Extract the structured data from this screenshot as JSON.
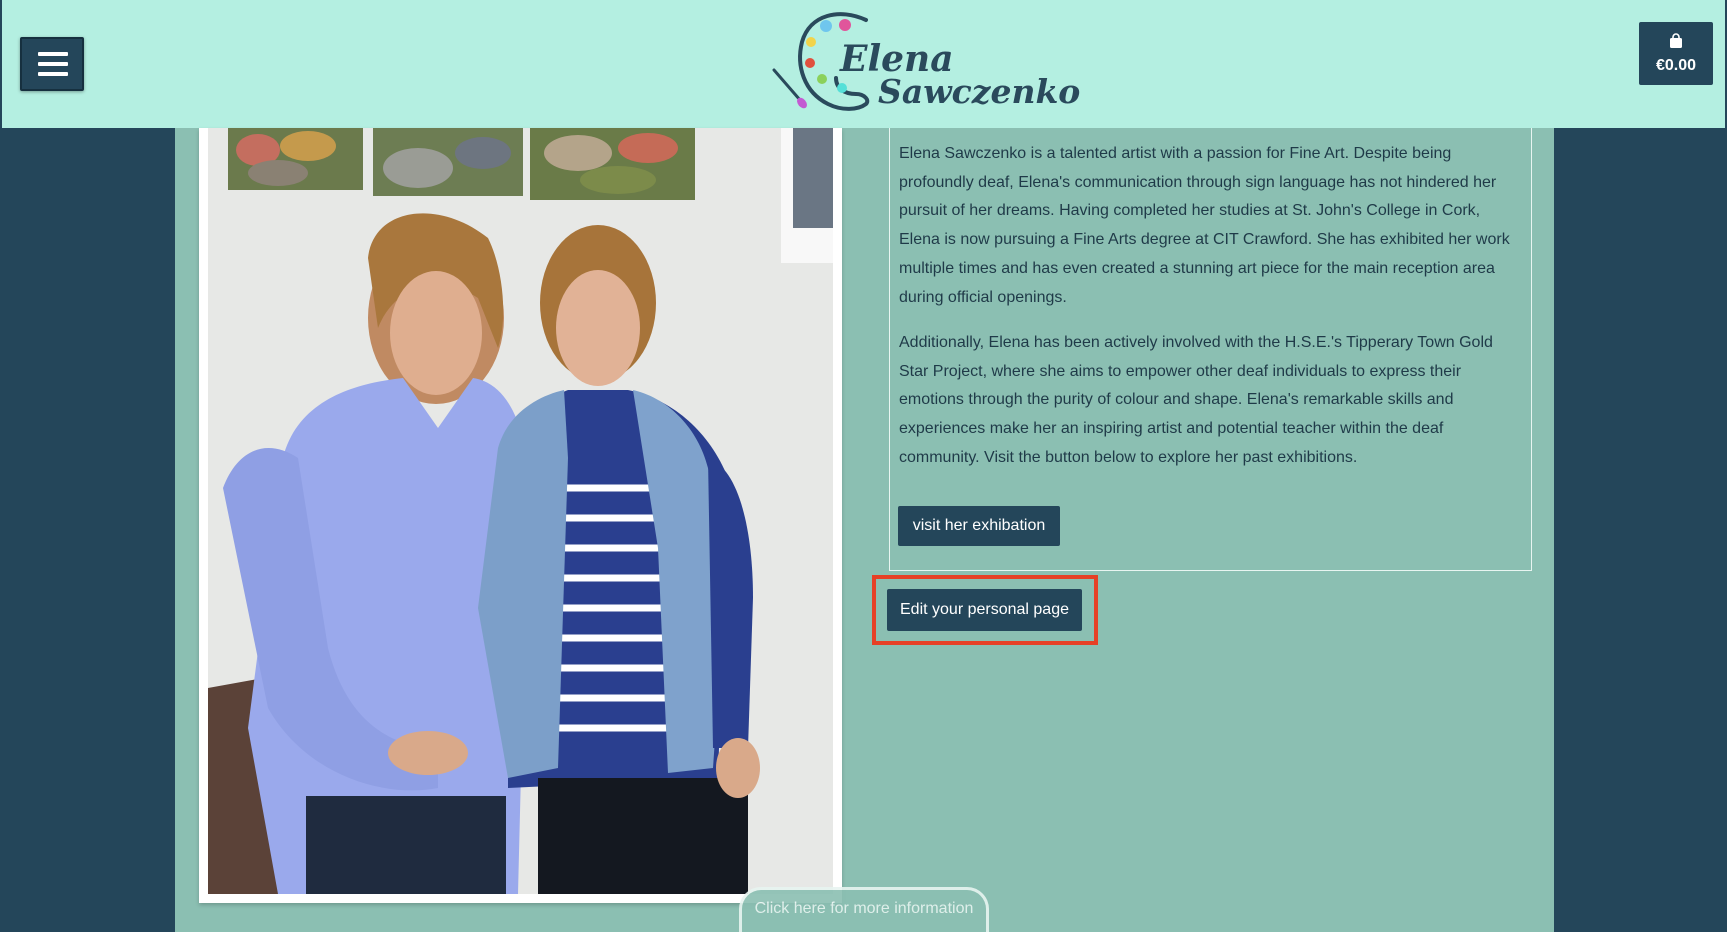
{
  "header": {
    "menu_icon": "hamburger-menu-icon",
    "logo": {
      "line1": "Elena",
      "line2": "Sawczenko",
      "icon": "paint-palette-icon"
    },
    "cart": {
      "icon": "shopping-bag-icon",
      "total": "€0.00"
    }
  },
  "main": {
    "photo_alt": "Photo of Elena Sawczenko with another woman at an art exhibition",
    "bio": {
      "paragraph1": "Elena Sawczenko is a talented artist with a passion for Fine Art. Despite being profoundly deaf, Elena's communication through sign language has not hindered her pursuit of her dreams. Having completed her studies at St. John's College in Cork, Elena is now pursuing a Fine Arts degree at CIT Crawford. She has exhibited her work multiple times and has even created a stunning art piece for the main reception area during official openings.",
      "paragraph2": "Additionally, Elena has been actively involved with the H.S.E.'s Tipperary Town Gold Star Project, where she aims to empower other deaf individuals to express their emotions through the purity of colour and shape. Elena's remarkable skills and experiences make her an inspiring artist and potential teacher within the deaf community. Visit the button below to explore her past exhibitions.",
      "exhibition_button": "visit her exhibation"
    },
    "edit_button": "Edit your personal page",
    "more_info_tab": "Click here for more information"
  },
  "colors": {
    "header_bg": "#b4efe1",
    "page_bg": "#24465a",
    "content_bg": "#8bbfb2",
    "button_bg": "#24465a",
    "highlight_border": "#e64026"
  }
}
